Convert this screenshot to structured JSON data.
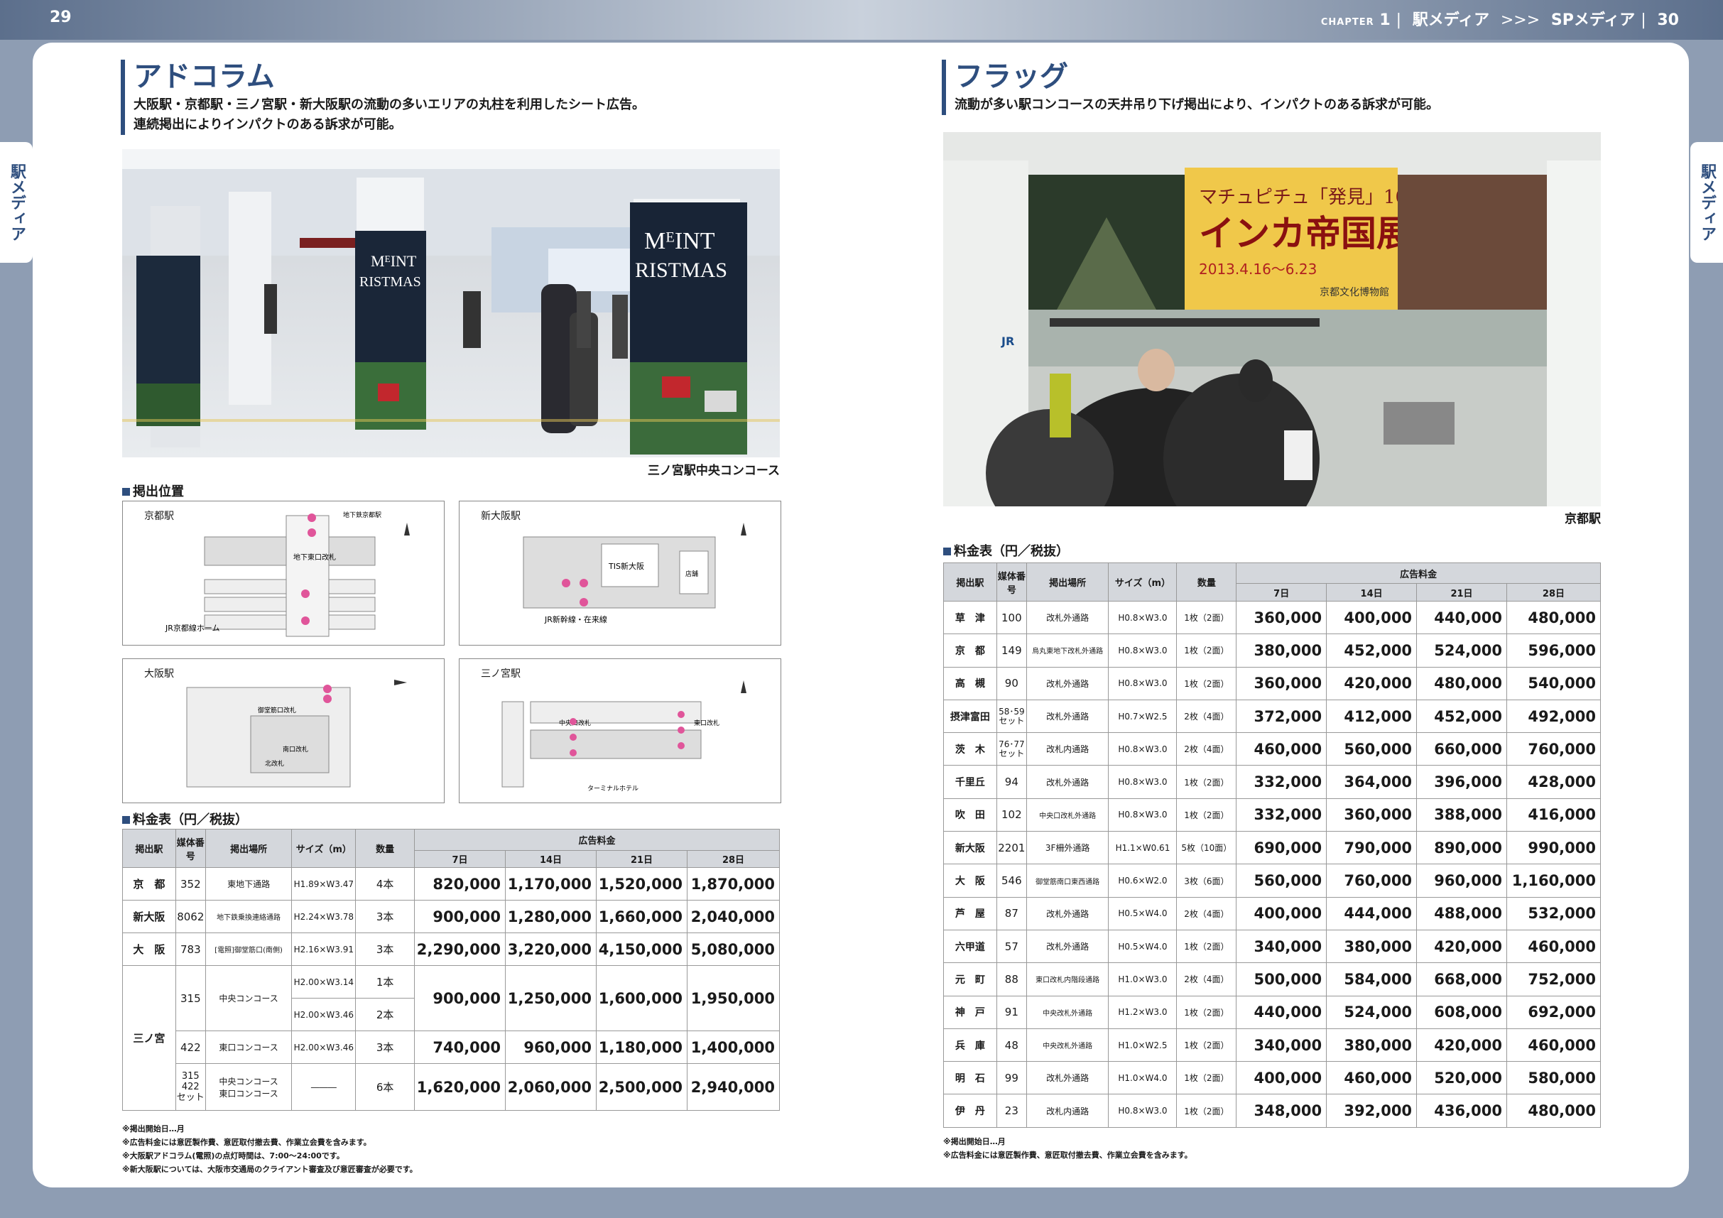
{
  "header": {
    "left_page": "29",
    "right_page": "30",
    "chapter_label": "CHAPTER",
    "chapter_num": "1",
    "section": "駅メディア",
    "arrows": ">>>",
    "subsection": "SPメディア"
  },
  "side_tabs": {
    "left": "駅メディア",
    "right": "駅メディア"
  },
  "left": {
    "title": "アドコラム",
    "desc1": "大阪駅・京都駅・三ノ宮駅・新大阪駅の流動の多いエリアの丸柱を利用したシート広告。",
    "desc2": "連続掲出によりインパクトのある訴求が可能。",
    "photo": {
      "caption": "三ノ宮駅中央コンコース",
      "ad_line1": "MᴱINT",
      "ad_line2": "RISTMAS"
    },
    "location_heading": "掲出位置",
    "maps": [
      "京都駅",
      "新大阪駅",
      "大阪駅",
      "三ノ宮駅"
    ],
    "map_labels": {
      "kyoto_tohoku": "東",
      "kyoto_kita": "地下東口改札",
      "kyoto_line": "JR京都線ホーム",
      "kyoto_subway": "地下鉄京都駅",
      "shinosaka_tis": "TIS新大阪",
      "shinosaka_jr": "JR新幹線・在来線",
      "shinosaka_shop": "店舗",
      "osaka_exit": "御堂筋口改札",
      "osaka_south": "南口改札",
      "osaka_north": "北改札",
      "sannomiya_east": "東口改札",
      "sannomiya_center": "中央口改札",
      "sannomiya_hotel": "ターミナルホテル"
    },
    "price_heading": "料金表（円／税抜）",
    "table": {
      "headers": {
        "station": "掲出駅",
        "media_no": "媒体番号",
        "place": "掲出場所",
        "size": "サイズ（m）",
        "qty": "数量",
        "fee": "広告料金",
        "d7": "7日",
        "d14": "14日",
        "d21": "21日",
        "d28": "28日"
      },
      "rows": [
        {
          "station": "京　都",
          "no": "352",
          "place": "東地下通路",
          "size": "H1.89×W3.47",
          "qty": "4本",
          "p7": "820,000",
          "p14": "1,170,000",
          "p21": "1,520,000",
          "p28": "1,870,000"
        },
        {
          "station": "新大阪",
          "no": "8062",
          "place": "地下鉄乗換連絡通路",
          "size": "H2.24×W3.78",
          "qty": "3本",
          "p7": "900,000",
          "p14": "1,280,000",
          "p21": "1,660,000",
          "p28": "2,040,000"
        },
        {
          "station": "大　阪",
          "no": "783",
          "place": "[電照]御堂筋口(南側)",
          "size": "H2.16×W3.91",
          "qty": "3本",
          "p7": "2,290,000",
          "p14": "3,220,000",
          "p21": "4,150,000",
          "p28": "5,080,000"
        }
      ],
      "sannomiya": {
        "station": "三ノ宮",
        "r315": {
          "no": "315",
          "place": "中央コンコース",
          "size_a": "H2.00×W3.14",
          "qty_a": "1本",
          "size_b": "H2.00×W3.46",
          "qty_b": "2本",
          "p7": "900,000",
          "p14": "1,250,000",
          "p21": "1,600,000",
          "p28": "1,950,000"
        },
        "r422": {
          "no": "422",
          "place": "東口コンコース",
          "size": "H2.00×W3.46",
          "qty": "3本",
          "p7": "740,000",
          "p14": "960,000",
          "p21": "1,180,000",
          "p28": "1,400,000"
        },
        "rset": {
          "no1": "315",
          "no2": "422",
          "no3": "セット",
          "place1": "中央コンコース",
          "place2": "東口コンコース",
          "size": "―――",
          "qty": "6本",
          "p7": "1,620,000",
          "p14": "2,060,000",
          "p21": "2,500,000",
          "p28": "2,940,000"
        }
      }
    },
    "notes": [
      "※掲出開始日…月",
      "※広告料金には意匠製作費、意匠取付撤去費、作業立会費を含みます。",
      "※大阪駅アドコラム(電照)の点灯時間は、7:00～24:00です。",
      "※新大阪駅については、大阪市交通局のクライアント審査及び意匠審査が必要です。"
    ]
  },
  "right": {
    "title": "フラッグ",
    "desc1": "流動が多い駅コンコースの天井吊り下げ掲出により、インパクトのある訴求が可能。",
    "photo": {
      "caption": "京都駅",
      "banner_sub": "マチュピチュ「発見」100年",
      "banner_main": "インカ帝国展",
      "banner_date": "2013.4.16～6.23",
      "banner_museum": "京都文化博物館",
      "jr_sign": "JR"
    },
    "price_heading": "料金表（円／税抜）",
    "table": {
      "headers": {
        "station": "掲出駅",
        "media_no": "媒体番号",
        "place": "掲出場所",
        "size": "サイズ（m）",
        "qty": "数量",
        "fee": "広告料金",
        "d7": "7日",
        "d14": "14日",
        "d21": "21日",
        "d28": "28日"
      },
      "rows": [
        {
          "station": "草　津",
          "no": "100",
          "place": "改札外通路",
          "size": "H0.8×W3.0",
          "qty": "1枚（2面）",
          "p7": "360,000",
          "p14": "400,000",
          "p21": "440,000",
          "p28": "480,000"
        },
        {
          "station": "京　都",
          "no": "149",
          "place": "烏丸東地下改札外通路",
          "size": "H0.8×W3.0",
          "qty": "1枚（2面）",
          "p7": "380,000",
          "p14": "452,000",
          "p21": "524,000",
          "p28": "596,000"
        },
        {
          "station": "高　槻",
          "no": "90",
          "place": "改札外通路",
          "size": "H0.8×W3.0",
          "qty": "1枚（2面）",
          "p7": "360,000",
          "p14": "420,000",
          "p21": "480,000",
          "p28": "540,000"
        },
        {
          "station": "摂津富田",
          "no": "58･59\nセット",
          "place": "改札外通路",
          "size": "H0.7×W2.5",
          "qty": "2枚（4面）",
          "p7": "372,000",
          "p14": "412,000",
          "p21": "452,000",
          "p28": "492,000"
        },
        {
          "station": "茨　木",
          "no": "76･77\nセット",
          "place": "改札内通路",
          "size": "H0.8×W3.0",
          "qty": "2枚（4面）",
          "p7": "460,000",
          "p14": "560,000",
          "p21": "660,000",
          "p28": "760,000"
        },
        {
          "station": "千里丘",
          "no": "94",
          "place": "改札外通路",
          "size": "H0.8×W3.0",
          "qty": "1枚（2面）",
          "p7": "332,000",
          "p14": "364,000",
          "p21": "396,000",
          "p28": "428,000"
        },
        {
          "station": "吹　田",
          "no": "102",
          "place": "中央口改札外通路",
          "size": "H0.8×W3.0",
          "qty": "1枚（2面）",
          "p7": "332,000",
          "p14": "360,000",
          "p21": "388,000",
          "p28": "416,000"
        },
        {
          "station": "新大阪",
          "no": "2201",
          "place": "3F柵外通路",
          "size": "H1.1×W0.61",
          "qty": "5枚（10面）",
          "p7": "690,000",
          "p14": "790,000",
          "p21": "890,000",
          "p28": "990,000"
        },
        {
          "station": "大　阪",
          "no": "546",
          "place": "御堂筋南口東西通路",
          "size": "H0.6×W2.0",
          "qty": "3枚（6面）",
          "p7": "560,000",
          "p14": "760,000",
          "p21": "960,000",
          "p28": "1,160,000"
        },
        {
          "station": "芦　屋",
          "no": "87",
          "place": "改札外通路",
          "size": "H0.5×W4.0",
          "qty": "2枚（4面）",
          "p7": "400,000",
          "p14": "444,000",
          "p21": "488,000",
          "p28": "532,000"
        },
        {
          "station": "六甲道",
          "no": "57",
          "place": "改札外通路",
          "size": "H0.5×W4.0",
          "qty": "1枚（2面）",
          "p7": "340,000",
          "p14": "380,000",
          "p21": "420,000",
          "p28": "460,000"
        },
        {
          "station": "元　町",
          "no": "88",
          "place": "東口改札内階段通路",
          "size": "H1.0×W3.0",
          "qty": "2枚（4面）",
          "p7": "500,000",
          "p14": "584,000",
          "p21": "668,000",
          "p28": "752,000"
        },
        {
          "station": "神　戸",
          "no": "91",
          "place": "中央改札外通路",
          "size": "H1.2×W3.0",
          "qty": "1枚（2面）",
          "p7": "440,000",
          "p14": "524,000",
          "p21": "608,000",
          "p28": "692,000"
        },
        {
          "station": "兵　庫",
          "no": "48",
          "place": "中央改札外通路",
          "size": "H1.0×W2.5",
          "qty": "1枚（2面）",
          "p7": "340,000",
          "p14": "380,000",
          "p21": "420,000",
          "p28": "460,000"
        },
        {
          "station": "明　石",
          "no": "99",
          "place": "改札外通路",
          "size": "H1.0×W4.0",
          "qty": "1枚（2面）",
          "p7": "400,000",
          "p14": "460,000",
          "p21": "520,000",
          "p28": "580,000"
        },
        {
          "station": "伊　丹",
          "no": "23",
          "place": "改札内通路",
          "size": "H0.8×W3.0",
          "qty": "1枚（2面）",
          "p7": "348,000",
          "p14": "392,000",
          "p21": "436,000",
          "p28": "480,000"
        }
      ]
    },
    "notes": [
      "※掲出開始日…月",
      "※広告料金には意匠製作費、意匠取付撤去費、作業立会費を含みます。"
    ]
  },
  "colors": {
    "accent": "#2e4e7e",
    "table_header": "#d4d7dc",
    "marker": "#e0559a"
  }
}
